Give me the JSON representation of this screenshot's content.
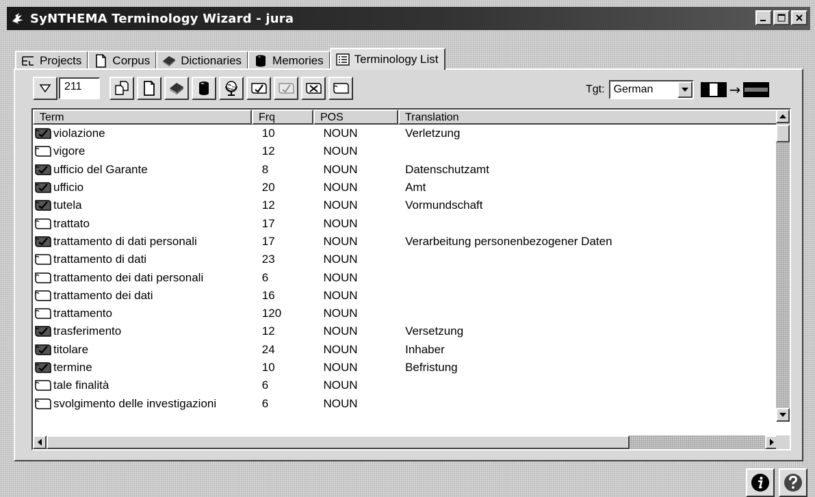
{
  "window": {
    "title": "SyNTHEMA Terminology Wizard - jura",
    "controls": [
      "minimize",
      "maximize",
      "close"
    ]
  },
  "tabs": [
    {
      "label": "Projects",
      "icon": "projects-tree-icon",
      "active": false
    },
    {
      "label": "Corpus",
      "icon": "document-icon",
      "active": false
    },
    {
      "label": "Dictionaries",
      "icon": "dictionary-books-icon",
      "active": false
    },
    {
      "label": "Memories",
      "icon": "database-cylinder-icon",
      "active": false
    },
    {
      "label": "Terminology List",
      "icon": "list-icon",
      "active": true
    }
  ],
  "toolbar": {
    "count": "211",
    "buttons": [
      {
        "icon": "filter-icon"
      },
      {
        "icon": "copy-documents-icon"
      },
      {
        "icon": "new-document-icon"
      },
      {
        "icon": "dictionary-books-icon"
      },
      {
        "icon": "database-cylinder-icon"
      },
      {
        "icon": "globe-stand-icon"
      },
      {
        "icon": "validated-term-icon"
      },
      {
        "icon": "validated-term-disabled-icon"
      },
      {
        "icon": "delete-term-icon"
      },
      {
        "icon": "unvalidated-term-icon"
      }
    ]
  },
  "target": {
    "label": "Tgt:",
    "value": "German"
  },
  "columns": {
    "term": "Term",
    "frq": "Frq",
    "pos": "POS",
    "translation": "Translation"
  },
  "rows": [
    {
      "term": "violazione",
      "frq": "10",
      "pos": "NOUN",
      "translation": "Verletzung",
      "validated": true
    },
    {
      "term": "vigore",
      "frq": "12",
      "pos": "NOUN",
      "translation": "",
      "validated": false
    },
    {
      "term": "ufficio del Garante",
      "frq": "8",
      "pos": "NOUN",
      "translation": "Datenschutzamt",
      "validated": true
    },
    {
      "term": "ufficio",
      "frq": "20",
      "pos": "NOUN",
      "translation": "Amt",
      "validated": true
    },
    {
      "term": "tutela",
      "frq": "12",
      "pos": "NOUN",
      "translation": "Vormundschaft",
      "validated": true
    },
    {
      "term": "trattato",
      "frq": "17",
      "pos": "NOUN",
      "translation": "",
      "validated": false
    },
    {
      "term": "trattamento di dati personali",
      "frq": "17",
      "pos": "NOUN",
      "translation": "Verarbeitung personenbezogener Daten",
      "validated": true
    },
    {
      "term": "trattamento di dati",
      "frq": "23",
      "pos": "NOUN",
      "translation": "",
      "validated": false
    },
    {
      "term": "trattamento dei dati personali",
      "frq": "6",
      "pos": "NOUN",
      "translation": "",
      "validated": false
    },
    {
      "term": "trattamento dei dati",
      "frq": "16",
      "pos": "NOUN",
      "translation": "",
      "validated": false
    },
    {
      "term": "trattamento",
      "frq": "120",
      "pos": "NOUN",
      "translation": "",
      "validated": false
    },
    {
      "term": "trasferimento",
      "frq": "12",
      "pos": "NOUN",
      "translation": "Versetzung",
      "validated": true
    },
    {
      "term": "titolare",
      "frq": "24",
      "pos": "NOUN",
      "translation": "Inhaber",
      "validated": true
    },
    {
      "term": "termine",
      "frq": "10",
      "pos": "NOUN",
      "translation": "Befristung",
      "validated": true
    },
    {
      "term": "tale finalità",
      "frq": "6",
      "pos": "NOUN",
      "translation": "",
      "validated": false
    },
    {
      "term": "svolgimento delle investigazioni",
      "frq": "6",
      "pos": "NOUN",
      "translation": "",
      "validated": false
    }
  ],
  "bottom_buttons": [
    {
      "icon": "info-icon"
    },
    {
      "icon": "help-icon"
    }
  ]
}
